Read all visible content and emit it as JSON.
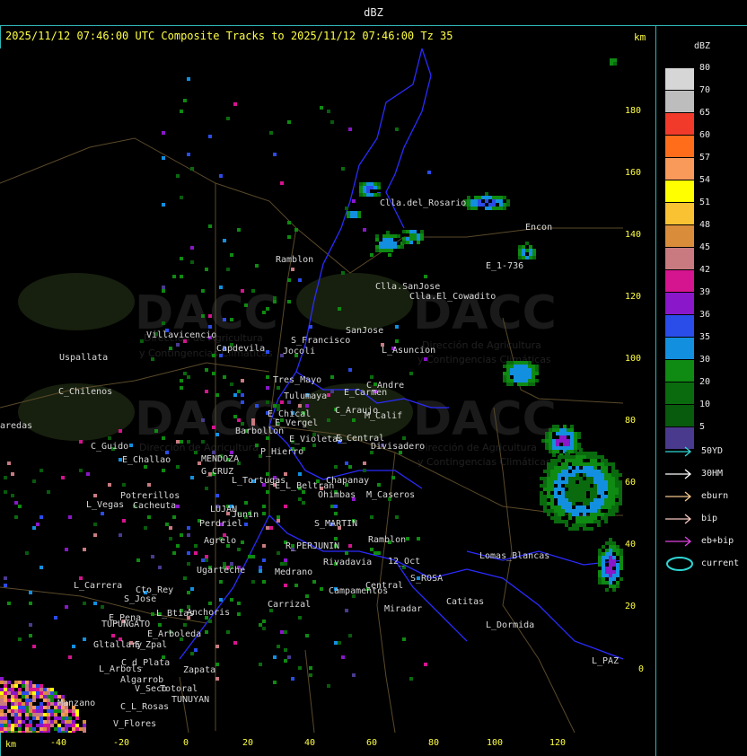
{
  "window": {
    "title": "dBZ"
  },
  "header": {
    "line": "2025/11/12 07:46:00 UTC Composite Tracks to 2025/11/12 07:46:00 Tz 35",
    "km_label": "km"
  },
  "axes": {
    "y_ticks": [
      "180",
      "160",
      "140",
      "120",
      "100",
      "80",
      "60",
      "40",
      "20",
      "0"
    ],
    "x_ticks": [
      "-40",
      "-20",
      "0",
      "20",
      "40",
      "60",
      "80",
      "100",
      "120"
    ],
    "x_km_label": "km"
  },
  "scale": {
    "title": "dBZ",
    "levels": [
      {
        "label": "80",
        "color": "#d6d6d6"
      },
      {
        "label": "70",
        "color": "#bdbdbd"
      },
      {
        "label": "65",
        "color": "#f23a2a"
      },
      {
        "label": "60",
        "color": "#ff6d1a"
      },
      {
        "label": "57",
        "color": "#f99a5a"
      },
      {
        "label": "54",
        "color": "#ffff00"
      },
      {
        "label": "51",
        "color": "#f9c233"
      },
      {
        "label": "48",
        "color": "#d98d3b"
      },
      {
        "label": "45",
        "color": "#c87a80"
      },
      {
        "label": "42",
        "color": "#d5148f"
      },
      {
        "label": "39",
        "color": "#8a17c9"
      },
      {
        "label": "36",
        "color": "#2a4ce8"
      },
      {
        "label": "35",
        "color": "#138fe0"
      },
      {
        "label": "30",
        "color": "#0f8a12"
      },
      {
        "label": "20",
        "color": "#0a6a0e"
      },
      {
        "label": "10",
        "color": "#085a0c"
      },
      {
        "label": "5",
        "color": "#4a3a8e"
      }
    ]
  },
  "legend": {
    "items": [
      {
        "label": "50YD",
        "color": "#2fd6d6"
      },
      {
        "label": "30HM",
        "color": "#ffffff"
      },
      {
        "label": "eburn",
        "color": "#f5c78a"
      },
      {
        "label": "bip",
        "color": "#f7c8c0"
      },
      {
        "label": "eb+bip",
        "color": "#e040e0"
      },
      {
        "label": "current",
        "color": "#2fd6d6"
      }
    ]
  },
  "watermark": {
    "brand": "DACC",
    "subtitle_1": "Dirección de Agricultura",
    "subtitle_2": "y Contingencias Climáticas"
  },
  "places": [
    {
      "name": "Clla.del_Rosario"
    },
    {
      "name": "Encon"
    },
    {
      "name": "E_1-736"
    },
    {
      "name": "Ramblon"
    },
    {
      "name": "Clla.SanJose"
    },
    {
      "name": "Clla.El_Cowadito"
    },
    {
      "name": "Villavicencio"
    },
    {
      "name": "Uspallata"
    },
    {
      "name": "Capdevila"
    },
    {
      "name": "S_Francisco"
    },
    {
      "name": "Jocoli"
    },
    {
      "name": "SanJose"
    },
    {
      "name": "L_Asuncion"
    },
    {
      "name": "Tres_Mayo"
    },
    {
      "name": "C_Andre"
    },
    {
      "name": "C_Chilenos"
    },
    {
      "name": "Tulumaya"
    },
    {
      "name": "E_Carmen"
    },
    {
      "name": "C_Araujo"
    },
    {
      "name": "E_Chical"
    },
    {
      "name": "M_Calif"
    },
    {
      "name": "E_Vergel"
    },
    {
      "name": "aredas"
    },
    {
      "name": "Barbollon"
    },
    {
      "name": "E_Violetas"
    },
    {
      "name": "E_Central"
    },
    {
      "name": "Divisadero"
    },
    {
      "name": "C_Guido"
    },
    {
      "name": "P_Hierro"
    },
    {
      "name": "E_Challao"
    },
    {
      "name": "MENDOZA"
    },
    {
      "name": "G_CRUZ"
    },
    {
      "name": "L_Tortugas"
    },
    {
      "name": "Chapanay"
    },
    {
      "name": "E_L_Beltran"
    },
    {
      "name": "Potrerillos"
    },
    {
      "name": "Ohimbas"
    },
    {
      "name": "M_Caseros"
    },
    {
      "name": "L_Vegas"
    },
    {
      "name": "Cacheuta"
    },
    {
      "name": "LUJAN"
    },
    {
      "name": "Junin"
    },
    {
      "name": "Perdriel"
    },
    {
      "name": "S_MARTIN"
    },
    {
      "name": "Agrelo"
    },
    {
      "name": "R_PERJUNIN"
    },
    {
      "name": "Ramblon2"
    },
    {
      "name": "Ugarteche"
    },
    {
      "name": "Lomas_Blancas"
    },
    {
      "name": "Rivadavia"
    },
    {
      "name": "12_Oct"
    },
    {
      "name": "Medrano"
    },
    {
      "name": "Anchoris"
    },
    {
      "name": "Campamentos"
    },
    {
      "name": "S_ROSA"
    },
    {
      "name": "L_Carrera"
    },
    {
      "name": "Cto_Rey"
    },
    {
      "name": "S_Jose"
    },
    {
      "name": "Catitas"
    },
    {
      "name": "Carrizal"
    },
    {
      "name": "Central"
    },
    {
      "name": "E_Pena"
    },
    {
      "name": "L_Btias"
    },
    {
      "name": "TUPUNGATO"
    },
    {
      "name": "Miradar"
    },
    {
      "name": "L_Dormida"
    },
    {
      "name": "E_Arboleda"
    },
    {
      "name": "Gltallary"
    },
    {
      "name": "E_Zpal"
    },
    {
      "name": "C_d_Plata"
    },
    {
      "name": "L_Arbols"
    },
    {
      "name": "Zapata"
    },
    {
      "name": "L_PAZ"
    },
    {
      "name": "Algarrob"
    },
    {
      "name": "V_Seco"
    },
    {
      "name": "Totoral"
    },
    {
      "name": "TUNUYAN"
    },
    {
      "name": "Manzano"
    },
    {
      "name": "C_L_Rosas"
    },
    {
      "name": "V_Flores"
    }
  ]
}
